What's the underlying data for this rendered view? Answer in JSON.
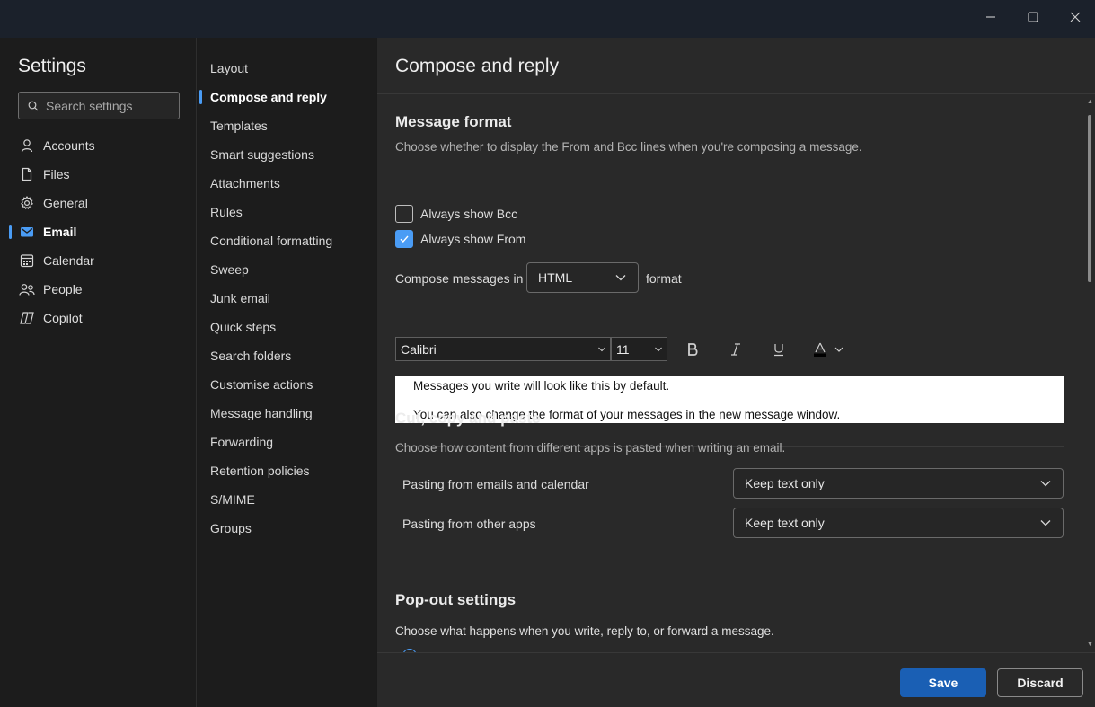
{
  "window": {
    "controls": [
      "minimize",
      "maximize",
      "close"
    ]
  },
  "sidebar": {
    "title": "Settings",
    "search_placeholder": "Search settings",
    "items": [
      {
        "label": "Accounts",
        "icon": "person-icon"
      },
      {
        "label": "Files",
        "icon": "file-icon"
      },
      {
        "label": "General",
        "icon": "gear-icon"
      },
      {
        "label": "Email",
        "icon": "mail-icon",
        "active": true
      },
      {
        "label": "Calendar",
        "icon": "calendar-icon"
      },
      {
        "label": "People",
        "icon": "people-icon"
      },
      {
        "label": "Copilot",
        "icon": "copilot-icon"
      }
    ]
  },
  "subnav": {
    "items": [
      {
        "label": "Layout"
      },
      {
        "label": "Compose and reply",
        "active": true
      },
      {
        "label": "Templates"
      },
      {
        "label": "Smart suggestions"
      },
      {
        "label": "Attachments"
      },
      {
        "label": "Rules"
      },
      {
        "label": "Conditional formatting"
      },
      {
        "label": "Sweep"
      },
      {
        "label": "Junk email"
      },
      {
        "label": "Quick steps"
      },
      {
        "label": "Search folders"
      },
      {
        "label": "Customise actions"
      },
      {
        "label": "Message handling"
      },
      {
        "label": "Forwarding"
      },
      {
        "label": "Retention policies"
      },
      {
        "label": "S/MIME"
      },
      {
        "label": "Groups"
      }
    ]
  },
  "main": {
    "title": "Compose and reply",
    "message_format": {
      "title": "Message format",
      "description": "Choose whether to display the From and Bcc lines when you're composing a message.",
      "always_show_bcc": {
        "label": "Always show Bcc",
        "checked": false
      },
      "always_show_from": {
        "label": "Always show From",
        "checked": true
      },
      "compose_label": "Compose messages in",
      "compose_value": "HTML",
      "compose_suffix": "format",
      "font_family": "Calibri",
      "font_size": "11",
      "preview_line_1": "Messages you write will look like this by default.",
      "preview_line_2": "You can also change the format of your messages in the new message window."
    },
    "cut_copy_paste": {
      "title": "Cut, copy and paste",
      "description": "Choose how content from different apps is pasted when writing an email.",
      "rows": [
        {
          "label": "Pasting from emails and calendar",
          "value": "Keep text only"
        },
        {
          "label": "Pasting from other apps",
          "value": "Keep text only"
        }
      ]
    },
    "popout": {
      "title": "Pop-out settings",
      "description": "Choose what happens when you write, reply to, or forward a message."
    }
  },
  "footer": {
    "save_label": "Save",
    "discard_label": "Discard"
  },
  "colors": {
    "accent": "#4a9cf5",
    "primary_button": "#1a5fb4",
    "titlebar": "#1b212b",
    "panel": "#292929",
    "sidebar": "#1c1c1c"
  }
}
